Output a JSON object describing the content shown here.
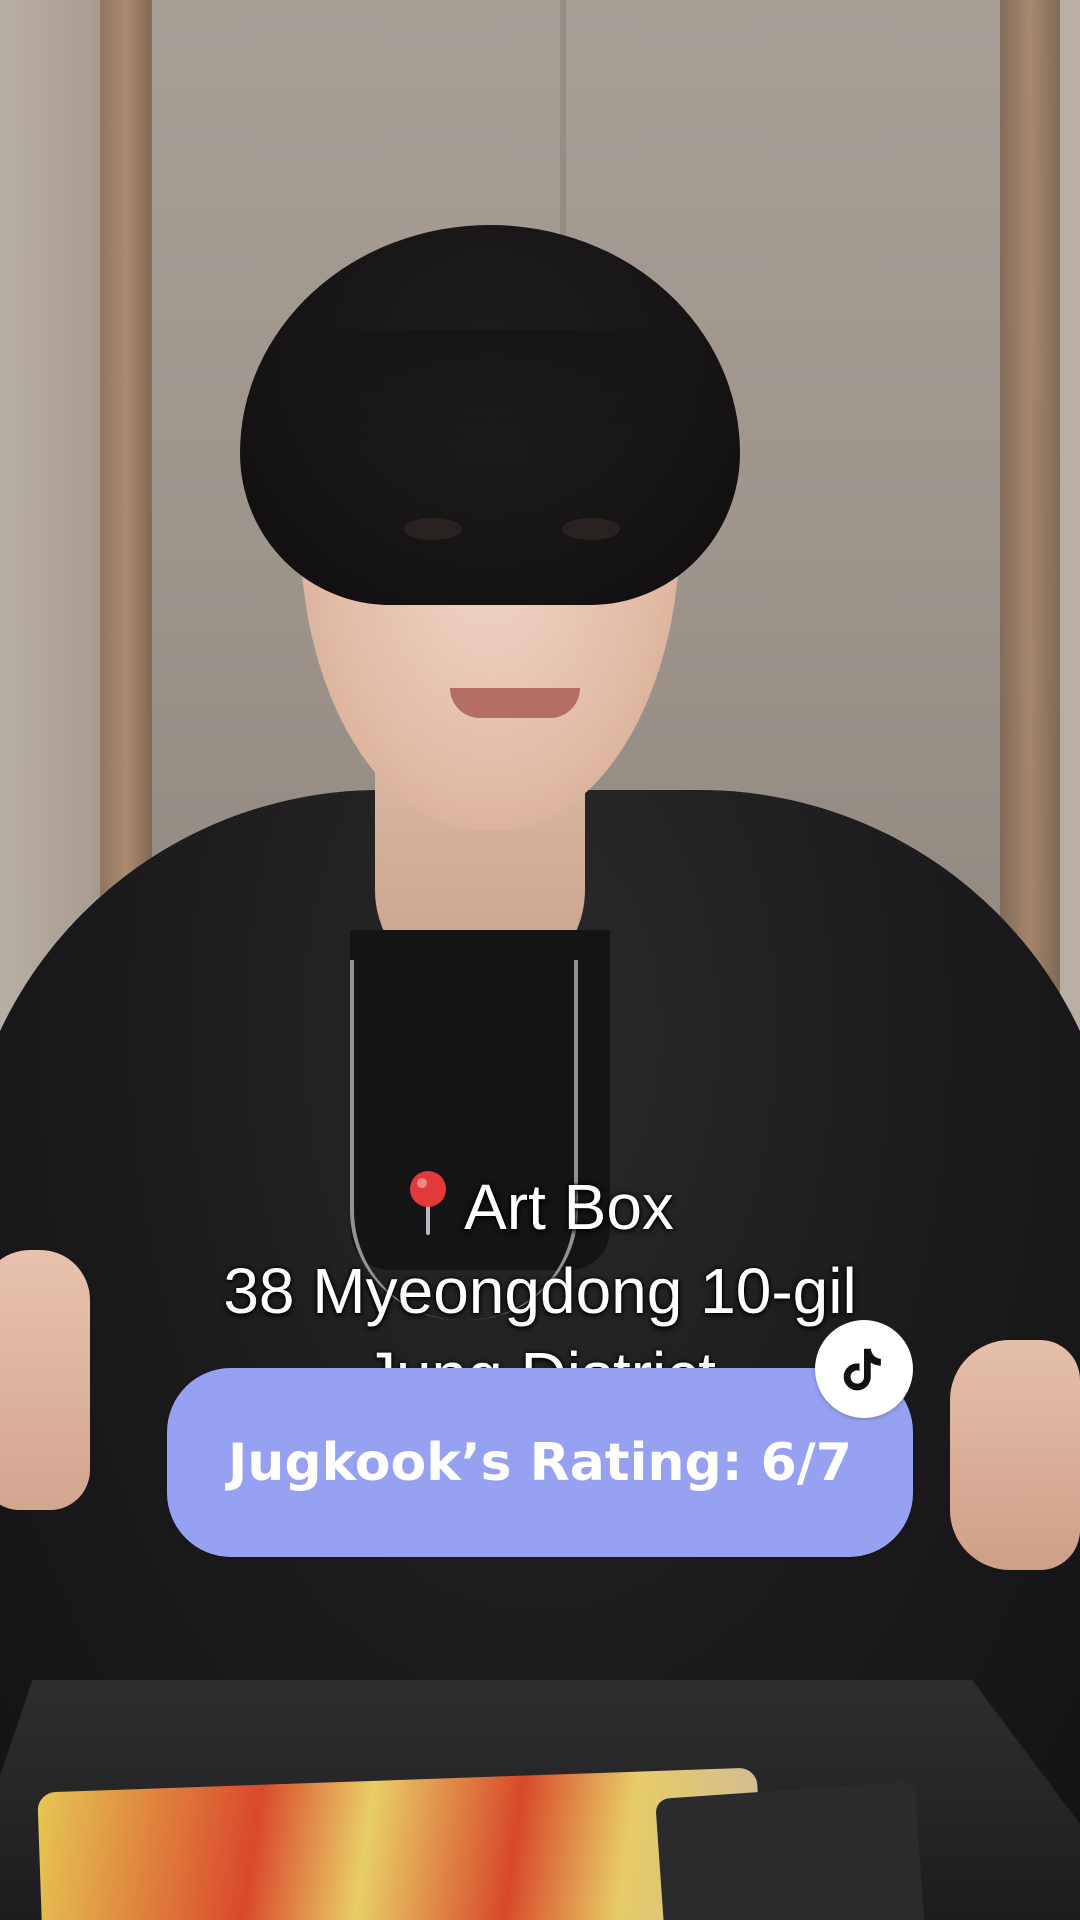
{
  "overlay": {
    "caption_lines": [
      "Art Box",
      "38 Myeongdong 10-gil",
      "Jung District"
    ],
    "pin_icon": "round-pushpin-icon",
    "rating": "Jugkook’s Rating: 6/7",
    "rating_pill_color": "#96a1f2",
    "app_badge_icon": "tiktok-logo-icon"
  }
}
